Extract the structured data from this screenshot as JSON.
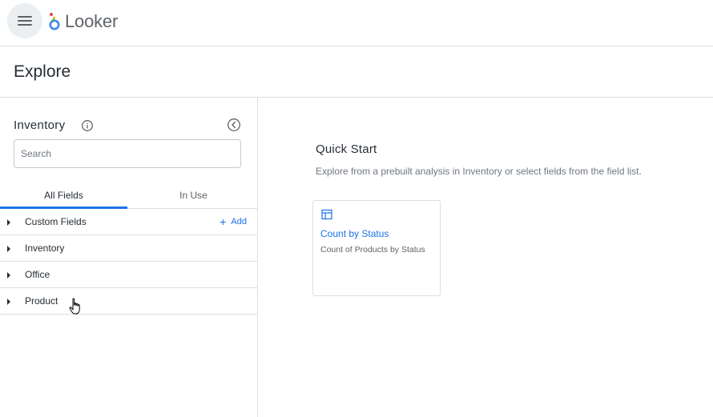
{
  "app": {
    "name": "Looker",
    "colors": {
      "accent": "#1a73e8",
      "text": "#262d33",
      "muted": "#707781",
      "border": "#dedede"
    }
  },
  "topbar": {
    "menu_icon": "hamburger-menu-icon",
    "logo_icon": "looker-logo-icon",
    "logo_text": "Looker"
  },
  "header": {
    "title": "Explore"
  },
  "sidebar": {
    "title": "Inventory",
    "info_icon": "info-icon",
    "collapse_icon": "chevron-left-circle-icon",
    "search": {
      "placeholder": "Search",
      "value": ""
    },
    "tabs": [
      {
        "label": "All Fields",
        "active": true
      },
      {
        "label": "In Use",
        "active": false
      }
    ],
    "groups": [
      {
        "label": "Custom Fields",
        "action": "Add"
      },
      {
        "label": "Inventory"
      },
      {
        "label": "Office"
      },
      {
        "label": "Product"
      }
    ]
  },
  "main": {
    "quick_start": {
      "title": "Quick Start",
      "subtitle": "Explore from a prebuilt analysis in Inventory or select fields from the field list.",
      "cards": [
        {
          "icon": "table-icon",
          "title": "Count by Status",
          "description": "Count of Products by Status"
        }
      ]
    }
  }
}
